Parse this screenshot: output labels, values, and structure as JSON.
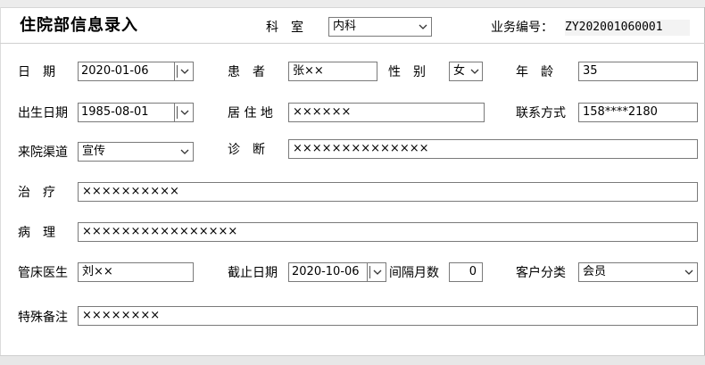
{
  "header": {
    "title": "住院部信息录入",
    "dept_label": "科　室",
    "dept_value": "内科",
    "bizno_label": "业务编号：",
    "bizno_value": "ZY202001060001"
  },
  "form": {
    "date_label": "日　期",
    "date_value": "2020-01-06",
    "patient_label": "患　者",
    "patient_value": "张××",
    "gender_label": "性　别",
    "gender_value": "女",
    "age_label": "年　龄",
    "age_value": "35",
    "birth_label": "出生日期",
    "birth_value": "1985-08-01",
    "address_label": "居 住 地",
    "address_value": "××××××",
    "contact_label": "联系方式",
    "contact_value": "158****2180",
    "channel_label": "来院渠道",
    "channel_value": "宣传",
    "diagnosis_label": "诊　断",
    "diagnosis_value": "××××××××××××××",
    "treatment_label": "治　疗",
    "treatment_value": "××××××××××",
    "pathology_label": "病　理",
    "pathology_value": "××××××××××××××××",
    "doctor_label": "管床医生",
    "doctor_value": "刘××",
    "deadline_label": "截止日期",
    "deadline_value": "2020-10-06",
    "interval_label": "间隔月数",
    "interval_value": "0",
    "category_label": "客户分类",
    "category_value": "会员",
    "remark_label": "特殊备注",
    "remark_value": "××××××××"
  }
}
